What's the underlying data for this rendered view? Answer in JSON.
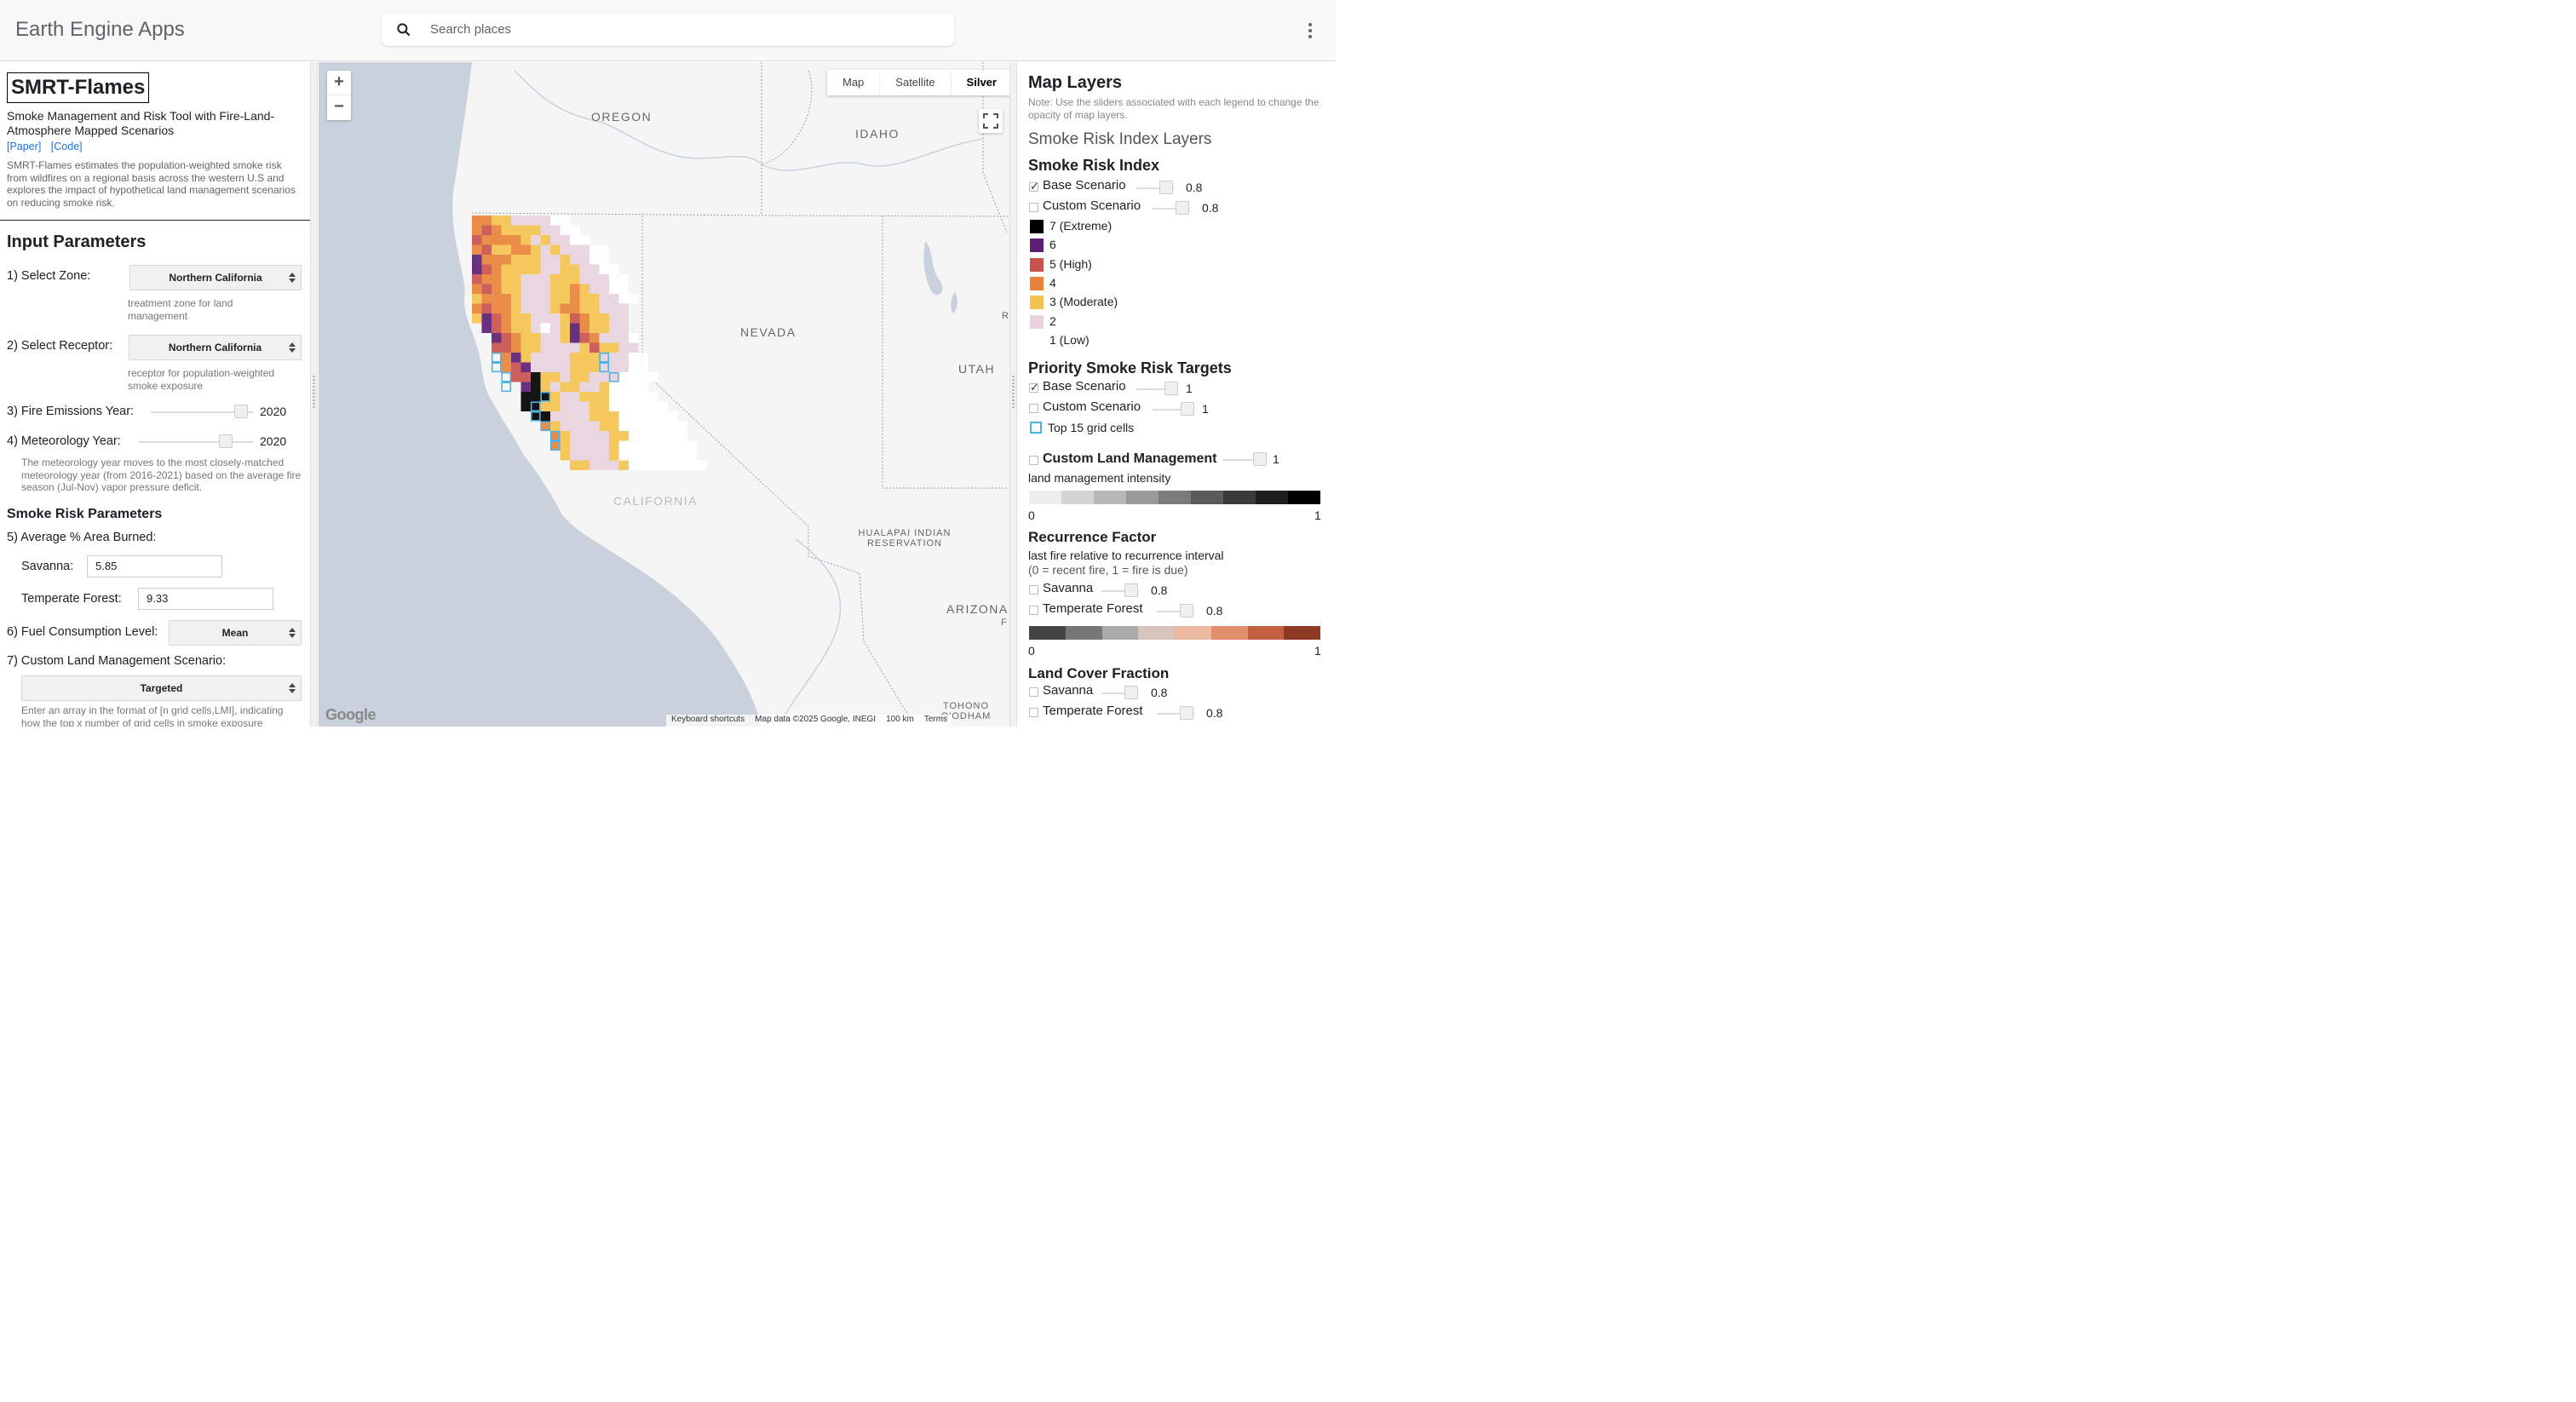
{
  "header": {
    "app_title": "Earth Engine Apps",
    "search_placeholder": "Search places"
  },
  "left_panel": {
    "brand": "SMRT-Flames",
    "subtitle": "Smoke Management and Risk Tool with Fire-Land-Atmosphere Mapped Scenarios",
    "paper_link": "[Paper]",
    "code_link": "[Code]",
    "description": "SMRT-Flames estimates the population-weighted smoke risk from wildfires on a regional basis across the western U.S and explores the impact of hypothetical land management scenarios on reducing smoke risk.",
    "input_heading": "Input Parameters",
    "zone_label": "1) Select Zone:",
    "zone_value": "Northern California",
    "zone_hint": "treatment zone for land management",
    "receptor_label": "2) Select Receptor:",
    "receptor_value": "Northern California",
    "receptor_hint": "receptor for population-weighted smoke exposure",
    "fire_year_label": "3) Fire Emissions Year:",
    "fire_year_value": "2020",
    "met_year_label": "4) Meteorology Year:",
    "met_year_value": "2020",
    "met_hint": "The meteorology year moves to the most closely-matched meteorology year (from 2016-2021) based on the average fire season (Jul-Nov) vapor pressure deficit.",
    "smoke_params_heading": "Smoke Risk Parameters",
    "area_burned_label": "5) Average % Area Burned:",
    "savanna_label": "Savanna:",
    "savanna_value": "5.85",
    "temperate_label": "Temperate Forest:",
    "temperate_value": "9.33",
    "fuel_label": "6) Fuel Consumption Level:",
    "fuel_value": "Mean",
    "custom_label": "7) Custom Land Management Scenario:",
    "custom_value": "Targeted",
    "custom_hint": "Enter an array in the format of [n grid cells,LMI], indicating how the top x number of grid cells in smoke exposure"
  },
  "map": {
    "zoom_in": "+",
    "zoom_out": "−",
    "types": [
      "Map",
      "Satellite",
      "Silver"
    ],
    "active_type": "Silver",
    "labels": {
      "oregon": "OREGON",
      "idaho": "IDAHO",
      "nevada": "NEVADA",
      "utah": "UTAH",
      "california": "CALIFORNIA",
      "arizona": "ARIZONA",
      "hualapai": "HUALAPAI INDIAN RESERVATION",
      "tohono": "TOHONO O'ODHAM",
      "r1": "R",
      "f1": "F"
    },
    "google": "Google",
    "attribution": [
      "Keyboard shortcuts",
      "Map data ©2025 Google, INEGI",
      "100 km",
      "Terms"
    ]
  },
  "right_panel": {
    "title": "Map Layers",
    "note": "Note: Use the sliders associated with each legend to change the opacity of map layers.",
    "section_title": "Smoke Risk Index Layers",
    "sri_heading": "Smoke Risk Index",
    "sri_base": "Base Scenario",
    "sri_base_val": "0.8",
    "sri_custom": "Custom Scenario",
    "sri_custom_val": "0.8",
    "legend": [
      {
        "label": "7 (Extreme)",
        "color": "#000000"
      },
      {
        "label": "6",
        "color": "#5c1f74"
      },
      {
        "label": "5 (High)",
        "color": "#c9534f"
      },
      {
        "label": "4",
        "color": "#e8833a"
      },
      {
        "label": "3 (Moderate)",
        "color": "#f4c34f"
      },
      {
        "label": "2",
        "color": "#e8d3de"
      },
      {
        "label": "1 (Low)",
        "color": "#ffffff"
      }
    ],
    "priority_heading": "Priority Smoke Risk Targets",
    "pr_base": "Base Scenario",
    "pr_base_val": "1",
    "pr_custom": "Custom Scenario",
    "pr_custom_val": "1",
    "top15": "Top 15 grid cells",
    "clm_heading": "Custom Land Management",
    "clm_val": "1",
    "clm_sub": "land management intensity",
    "clm_min": "0",
    "clm_max": "1",
    "gray_ramp": [
      "#eeeeee",
      "#d4d4d4",
      "#b8b8b8",
      "#9a9a9a",
      "#7a7a7a",
      "#5a5a5a",
      "#3a3a3a",
      "#1e1e1e",
      "#000000"
    ],
    "rec_heading": "Recurrence Factor",
    "rec_sub1": "last fire relative to recurrence interval",
    "rec_sub2": "(0 = recent fire, 1 = fire is due)",
    "rec_savanna": "Savanna",
    "rec_savanna_val": "0.8",
    "rec_temperate": "Temperate Forest",
    "rec_temperate_val": "0.8",
    "rec_ramp": [
      "#444444",
      "#777777",
      "#aaaaaa",
      "#d8c4bb",
      "#ecb8a0",
      "#e08e6c",
      "#c2603f",
      "#8c3b22"
    ],
    "rec_min": "0",
    "rec_max": "1",
    "lcf_heading": "Land Cover Fraction",
    "lcf_savanna": "Savanna",
    "lcf_savanna_val": "0.8",
    "lcf_temperate": "Temperate Forest",
    "lcf_temperate_val": "0.8"
  }
}
